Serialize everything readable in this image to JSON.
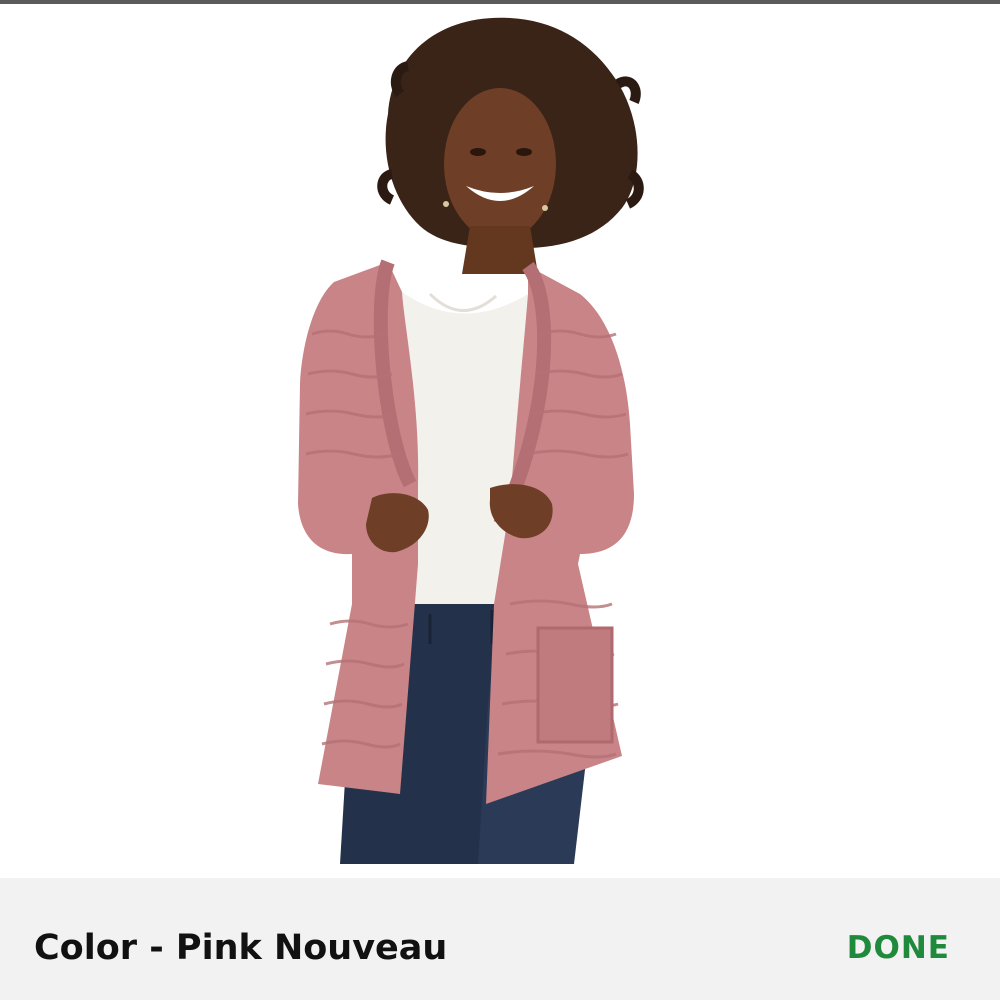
{
  "colors": {
    "top_rule": "#5b5b5b",
    "bottom_bar": "#f2f2f2",
    "label_text": "#111111",
    "done_text": "#1f8a3b"
  },
  "color_picker": {
    "label": "Color - Pink Nouveau",
    "done_label": "DONE"
  },
  "product_image": {
    "description_icon": "product-photo"
  }
}
